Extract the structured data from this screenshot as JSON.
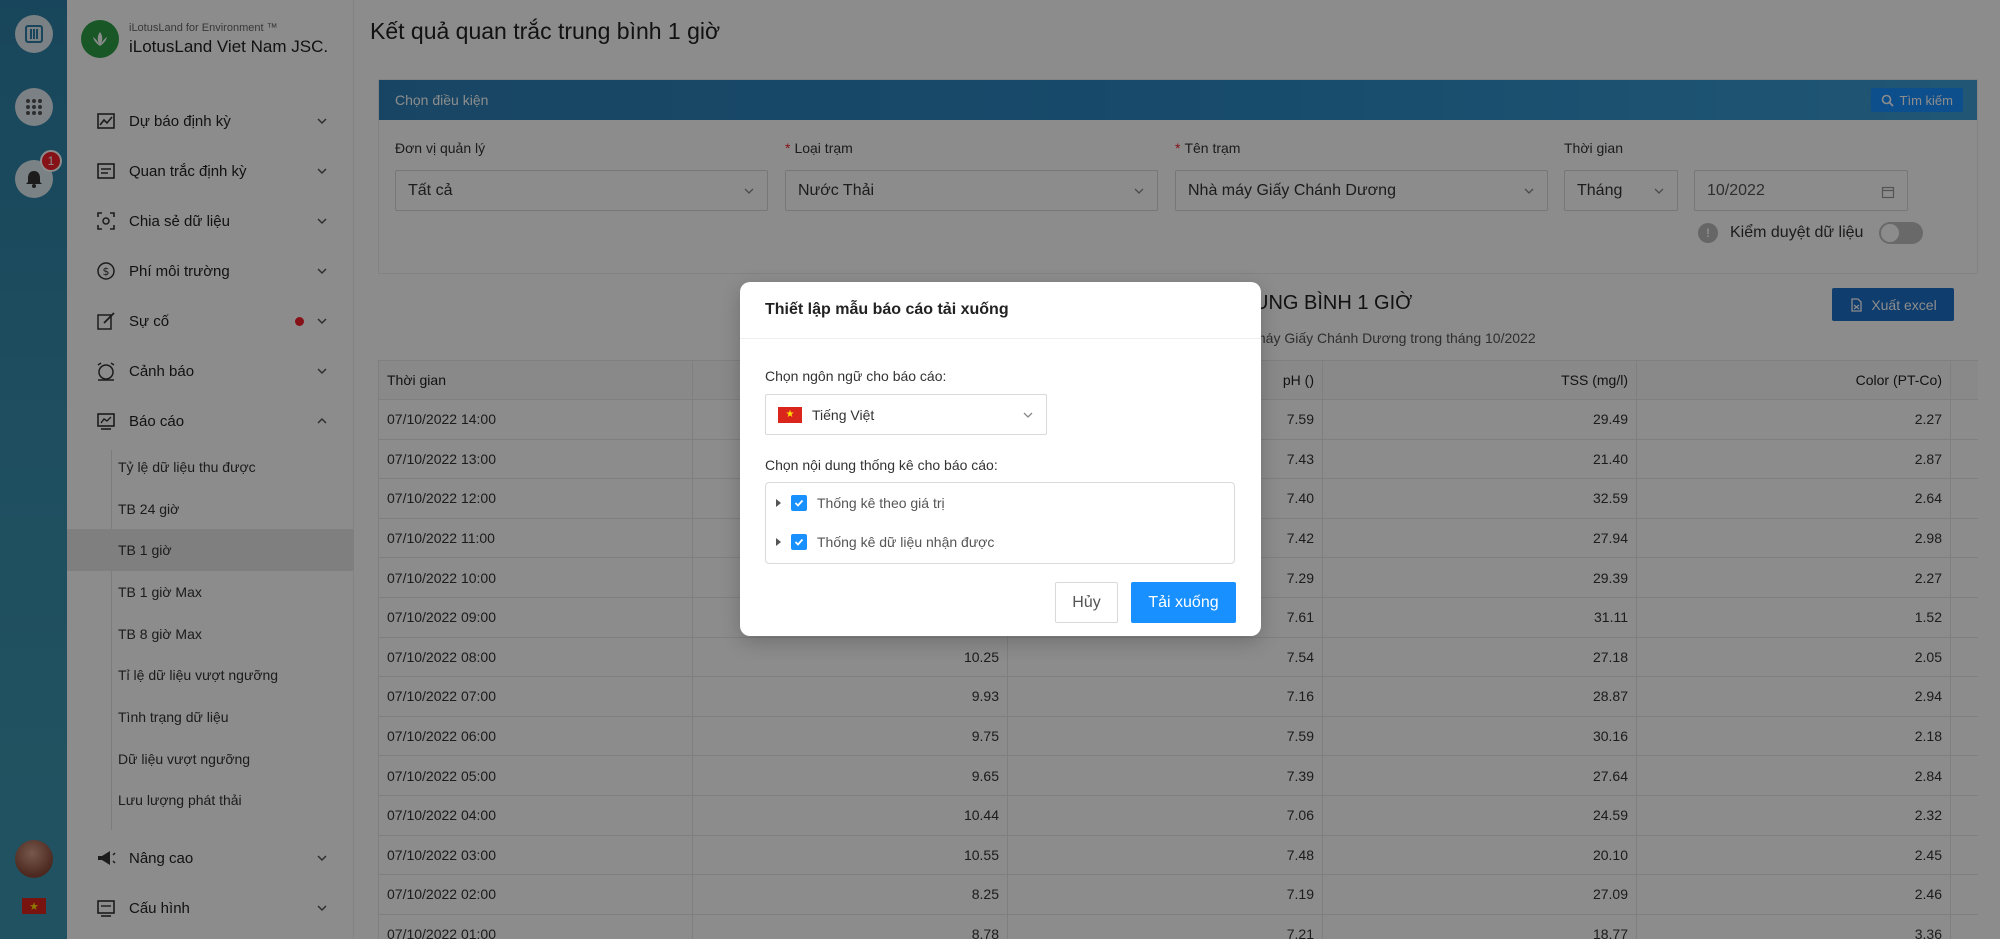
{
  "rail": {
    "notification_count": "1"
  },
  "brand": {
    "subtitle": "iLotusLand for Environment ™",
    "name": "iLotusLand Viet Nam JSC."
  },
  "sidebar": {
    "items": [
      {
        "label": "Dự báo định kỳ"
      },
      {
        "label": "Quan trắc định kỳ"
      },
      {
        "label": "Chia sẻ dữ liệu"
      },
      {
        "label": "Phí môi trường"
      },
      {
        "label": "Sự cố"
      },
      {
        "label": "Cảnh báo"
      },
      {
        "label": "Báo cáo"
      }
    ],
    "sub_items": [
      {
        "label": "Tỷ lệ dữ liệu thu được"
      },
      {
        "label": "TB 24 giờ"
      },
      {
        "label": "TB 1 giờ"
      },
      {
        "label": "TB 1 giờ Max"
      },
      {
        "label": "TB 8 giờ Max"
      },
      {
        "label": "Tỉ lệ dữ liệu vượt ngưỡng"
      },
      {
        "label": "Tình trạng dữ liệu"
      },
      {
        "label": "Dữ liệu vượt ngưỡng"
      },
      {
        "label": "Lưu lượng phát thải"
      }
    ],
    "bottom_items": [
      {
        "label": "Nâng cao"
      },
      {
        "label": "Cấu hình"
      }
    ]
  },
  "page": {
    "title": "Kết quả quan trắc trung bình 1 giờ"
  },
  "filter": {
    "header": "Chọn điều kiện",
    "search_label": "Tìm kiếm",
    "unit_label": "Đơn vị quản lý",
    "unit_value": "Tất cả",
    "type_label": "Loại trạm",
    "type_value": "Nước Thải",
    "station_label": "Tên trạm",
    "station_value": "Nhà máy Giấy Chánh Dương",
    "time_label": "Thời gian",
    "period_value": "Tháng",
    "month_value": "10/2022",
    "verify_label": "Kiểm duyệt dữ liệu"
  },
  "report": {
    "title_visible": "UNG BÌNH 1 GIỜ",
    "subtitle_visible": "máy Giấy Chánh Dương trong tháng 10/2022",
    "excel_label": "Xuất excel"
  },
  "table": {
    "headers": [
      "Thời gian",
      "",
      "pH ()",
      "TSS (mg/l)",
      "Color (PT-Co)"
    ],
    "rows": [
      {
        "time": "07/10/2022 14:00",
        "a": "",
        "ph": "7.59",
        "tss": "29.49",
        "color": "2.27"
      },
      {
        "time": "07/10/2022 13:00",
        "a": "",
        "ph": "7.43",
        "tss": "21.40",
        "color": "2.87"
      },
      {
        "time": "07/10/2022 12:00",
        "a": "",
        "ph": "7.40",
        "tss": "32.59",
        "color": "2.64"
      },
      {
        "time": "07/10/2022 11:00",
        "a": "",
        "ph": "7.42",
        "tss": "27.94",
        "color": "2.98"
      },
      {
        "time": "07/10/2022 10:00",
        "a": "",
        "ph": "7.29",
        "tss": "29.39",
        "color": "2.27"
      },
      {
        "time": "07/10/2022 09:00",
        "a": "",
        "ph": "7.61",
        "tss": "31.11",
        "color": "1.52"
      },
      {
        "time": "07/10/2022 08:00",
        "a": "10.25",
        "ph": "7.54",
        "tss": "27.18",
        "color": "2.05"
      },
      {
        "time": "07/10/2022 07:00",
        "a": "9.93",
        "ph": "7.16",
        "tss": "28.87",
        "color": "2.94"
      },
      {
        "time": "07/10/2022 06:00",
        "a": "9.75",
        "ph": "7.59",
        "tss": "30.16",
        "color": "2.18"
      },
      {
        "time": "07/10/2022 05:00",
        "a": "9.65",
        "ph": "7.39",
        "tss": "27.64",
        "color": "2.84"
      },
      {
        "time": "07/10/2022 04:00",
        "a": "10.44",
        "ph": "7.06",
        "tss": "24.59",
        "color": "2.32"
      },
      {
        "time": "07/10/2022 03:00",
        "a": "10.55",
        "ph": "7.48",
        "tss": "20.10",
        "color": "2.45"
      },
      {
        "time": "07/10/2022 02:00",
        "a": "8.25",
        "ph": "7.19",
        "tss": "27.09",
        "color": "2.46"
      },
      {
        "time": "07/10/2022 01:00",
        "a": "8.78",
        "ph": "7.21",
        "tss": "18.77",
        "color": "3.36"
      }
    ]
  },
  "modal": {
    "title": "Thiết lập mẫu báo cáo tải xuống",
    "lang_label": "Chọn ngôn ngữ cho báo cáo:",
    "lang_value": "Tiếng Việt",
    "content_label": "Chọn nội dung thống kê cho báo cáo:",
    "options": [
      {
        "label": "Thống kê theo giá trị",
        "checked": true
      },
      {
        "label": "Thống kê dữ liệu nhận được",
        "checked": true
      }
    ],
    "cancel_label": "Hủy",
    "download_label": "Tải xuống"
  },
  "colors": {
    "primary": "#1890ff",
    "rail": "#2d7fa6",
    "danger": "#f5222d"
  }
}
